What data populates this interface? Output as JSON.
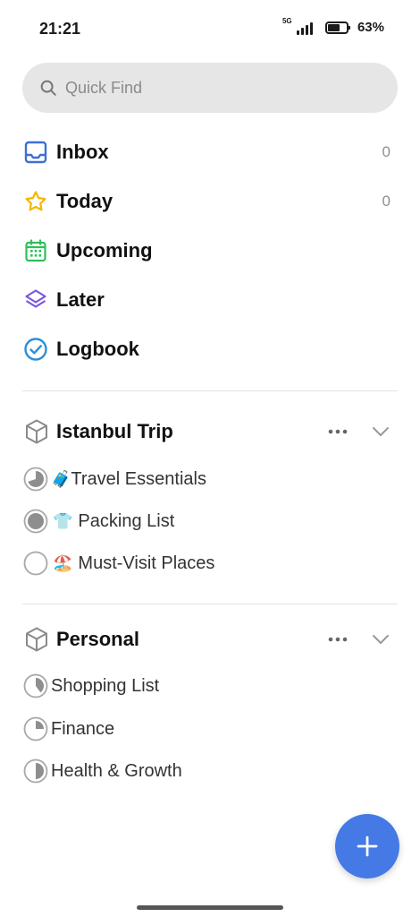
{
  "status": {
    "time": "21:21",
    "network": "5G",
    "battery": "63%",
    "battery_level": 0.63
  },
  "search": {
    "placeholder": "Quick Find",
    "icon": "search-icon"
  },
  "nav": [
    {
      "label": "Inbox",
      "count": "0",
      "icon": "inbox-icon",
      "color": "#3d6fd6"
    },
    {
      "label": "Today",
      "count": "0",
      "icon": "star-icon",
      "color": "#f5b700"
    },
    {
      "label": "Upcoming",
      "count": "",
      "icon": "calendar-icon",
      "color": "#2ec05a"
    },
    {
      "label": "Later",
      "count": "",
      "icon": "layers-icon",
      "color": "#7a55e0"
    },
    {
      "label": "Logbook",
      "count": "",
      "icon": "check-circle-icon",
      "color": "#2d8fd8"
    }
  ],
  "areas": [
    {
      "name": "Istanbul Trip",
      "icon": "cube-icon",
      "projects": [
        {
          "emoji": "🧳",
          "label": "Travel Essentials",
          "progress": 0.7
        },
        {
          "emoji": "👕",
          "label": "Packing List",
          "progress": 1.0
        },
        {
          "emoji": "🏖️",
          "label": "Must-Visit Places",
          "progress": 0.0
        }
      ]
    },
    {
      "name": "Personal",
      "icon": "cube-icon",
      "projects": [
        {
          "emoji": "",
          "label": "Shopping List",
          "progress": 0.4
        },
        {
          "emoji": "",
          "label": "Finance",
          "progress": 0.25
        },
        {
          "emoji": "",
          "label": "Health & Growth",
          "progress": 0.5
        }
      ]
    }
  ],
  "colors": {
    "accent": "#4479e6",
    "progress": "#8e8e8e",
    "muted": "#8f8f8f"
  }
}
